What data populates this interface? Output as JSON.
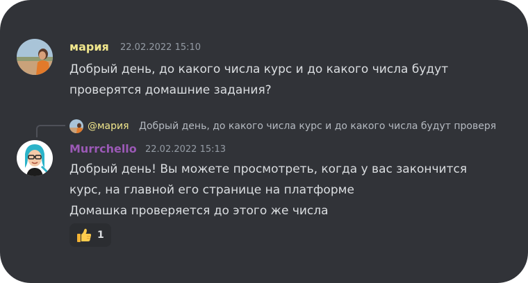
{
  "colors": {
    "background": "#313338",
    "author_maria": "#f0e68c",
    "author_murrchello": "#9b59b6",
    "timestamp": "#949ba4",
    "text": "#dbdee1"
  },
  "messages": [
    {
      "author": "мария",
      "timestamp": "22.02.2022 15:10",
      "text": "Добрый день, до какого числа курс и до какого числа будут\nпроверятся домашние задания?"
    },
    {
      "reply": {
        "mention": "@мария",
        "snippet": "Добрый день, до какого числа курс и до какого числа будут проверятся домашние задания?"
      },
      "author": "Murrchello",
      "timestamp": "22.02.2022 15:13",
      "text": "Добрый день! Вы можете просмотреть, когда у вас закончится\nкурс, на главной его странице на платформе\nДомашка проверяется до этого же числа",
      "reaction": {
        "emoji": "thumbs-up-icon",
        "count": "1"
      }
    }
  ]
}
